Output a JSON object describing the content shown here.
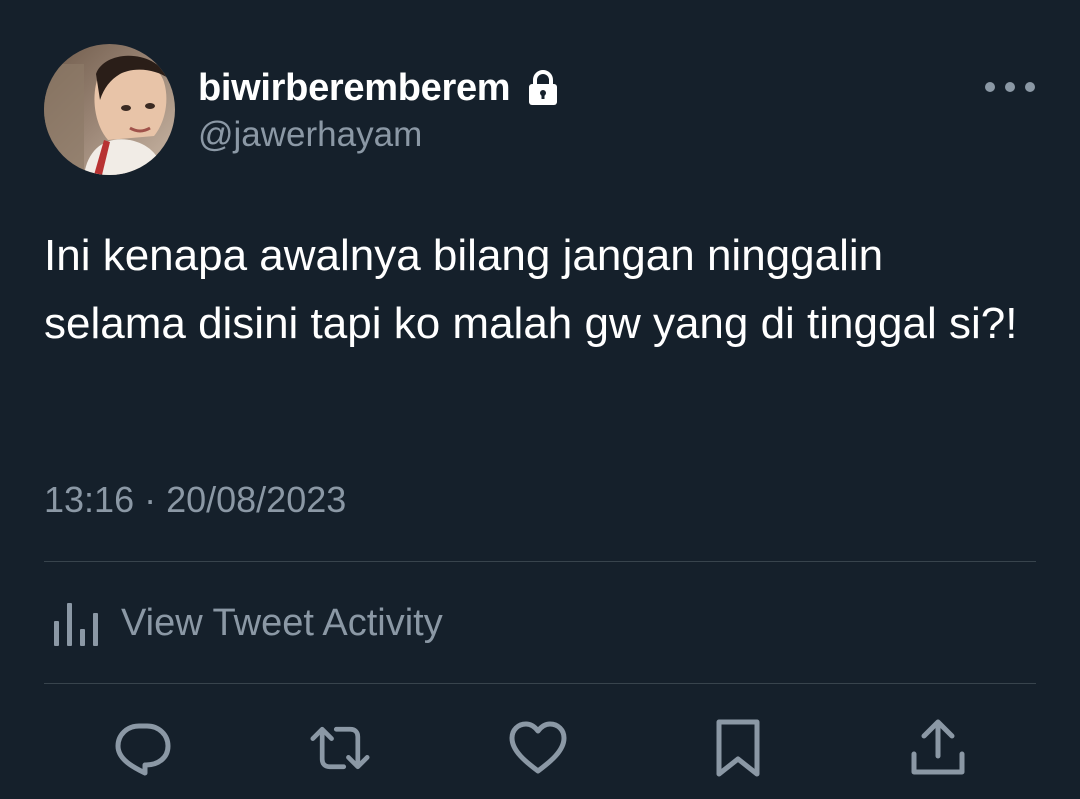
{
  "author": {
    "display_name": "biwirberemberem",
    "handle": "@jawerhayam",
    "avatar_icon": "user-avatar-photo",
    "protected_icon": "lock-icon"
  },
  "tweet": {
    "text": "Ini kenapa awalnya bilang jangan ninggalin selama disini tapi ko malah gw yang di tinggal si?!",
    "timestamp": "13:16 · 20/08/2023"
  },
  "activity": {
    "label": "View Tweet Activity",
    "icon": "bar-chart-icon"
  },
  "actions": {
    "reply_icon": "reply-icon",
    "retweet_icon": "retweet-icon",
    "like_icon": "heart-icon",
    "bookmark_icon": "bookmark-icon",
    "share_icon": "share-icon"
  },
  "colors": {
    "background": "#15202b",
    "primary_text": "#ffffff",
    "secondary_text": "#8b98a5",
    "divider": "#38444d"
  }
}
